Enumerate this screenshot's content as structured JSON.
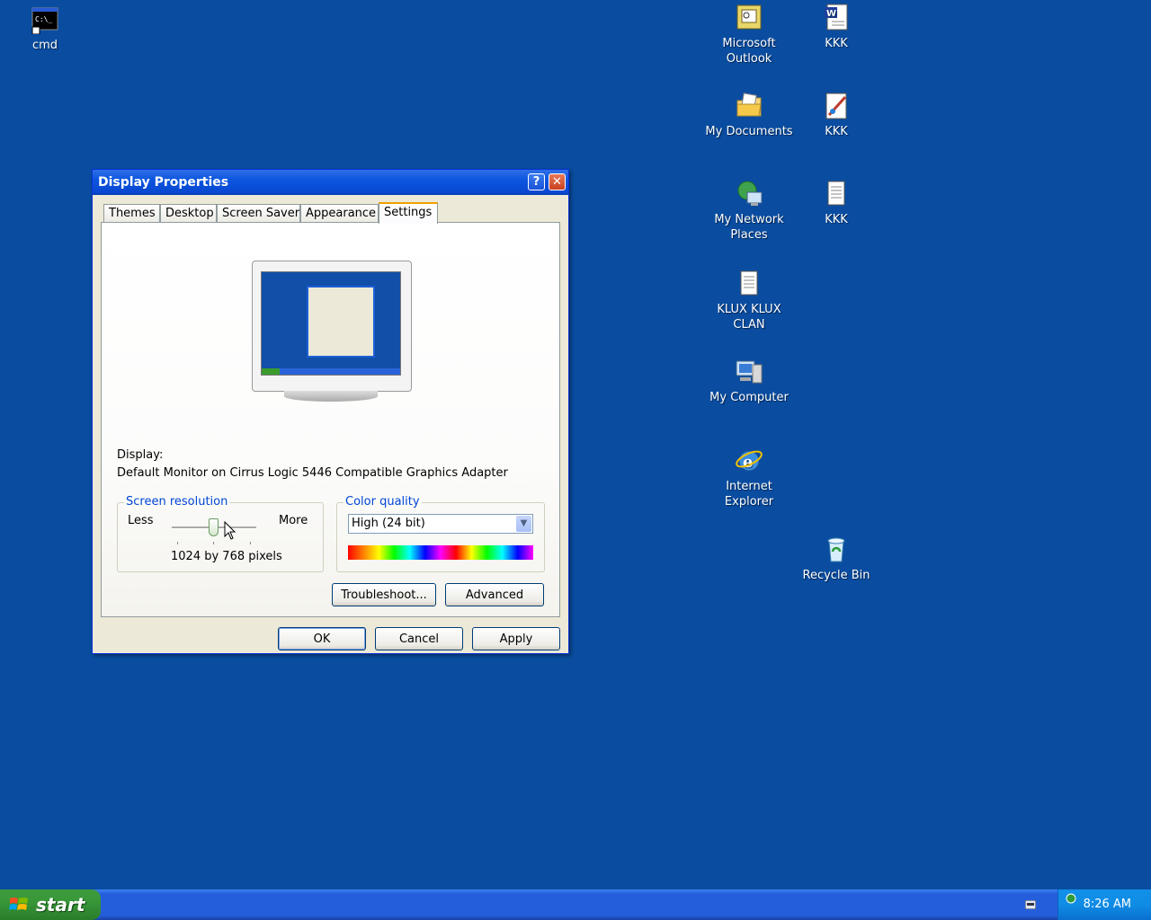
{
  "desktop": {
    "icons": [
      {
        "id": "cmd",
        "label": "cmd",
        "icon": "command-prompt-icon"
      },
      {
        "id": "outlook",
        "label": "Microsoft Outlook",
        "icon": "outlook-icon"
      },
      {
        "id": "kkk1",
        "label": "KKK",
        "icon": "word-document-icon"
      },
      {
        "id": "mydocs",
        "label": "My Documents",
        "icon": "folder-icon"
      },
      {
        "id": "kkk2",
        "label": "KKK",
        "icon": "paint-image-icon"
      },
      {
        "id": "network",
        "label": "My Network Places",
        "icon": "network-places-icon"
      },
      {
        "id": "kkk3",
        "label": "KKK",
        "icon": "text-document-icon"
      },
      {
        "id": "klux",
        "label": "KLUX KLUX CLAN",
        "icon": "text-document-icon"
      },
      {
        "id": "mycomputer",
        "label": "My Computer",
        "icon": "my-computer-icon"
      },
      {
        "id": "ie",
        "label": "Internet Explorer",
        "icon": "internet-explorer-icon"
      },
      {
        "id": "recycle",
        "label": "Recycle Bin",
        "icon": "recycle-bin-icon"
      }
    ]
  },
  "dialog": {
    "title": "Display Properties",
    "help_glyph": "?",
    "close_glyph": "✕",
    "tabs": [
      "Themes",
      "Desktop",
      "Screen Saver",
      "Appearance",
      "Settings"
    ],
    "active_tab": "Settings",
    "display_label": "Display:",
    "display_value": "Default Monitor on Cirrus Logic 5446 Compatible Graphics Adapter",
    "resolution": {
      "title": "Screen resolution",
      "less": "Less",
      "more": "More",
      "value": "1024 by 768 pixels"
    },
    "color_quality": {
      "title": "Color quality",
      "selected": "High (24 bit)"
    },
    "buttons": {
      "troubleshoot": "Troubleshoot...",
      "advanced": "Advanced",
      "ok": "OK",
      "cancel": "Cancel",
      "apply": "Apply"
    }
  },
  "taskbar": {
    "start_label": "start",
    "clock": "8:26 AM"
  },
  "colors": {
    "desktop": "#0a4da0",
    "titlebar": "#0b55e0",
    "group_title": "#0046d5"
  }
}
